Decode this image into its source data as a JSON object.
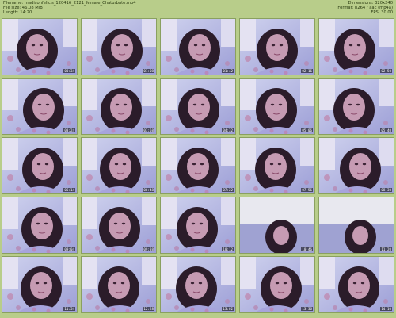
{
  "header": {
    "filename": "Filename: madisonfelicis_120416_2121_female_Chaturbate.mp4",
    "filesize": "File size: 46.08 MiB",
    "length": "Length: 14:20",
    "dimensions": "Dimensions: 320x240",
    "format": "Format: h264 / aac (mp4a)",
    "fps": "FPS: 30.00"
  },
  "thumbnails": [
    {
      "timestamp": "00:34",
      "variant": "face"
    },
    {
      "timestamp": "01:08",
      "variant": "face"
    },
    {
      "timestamp": "01:42",
      "variant": "face"
    },
    {
      "timestamp": "02:16",
      "variant": "face"
    },
    {
      "timestamp": "02:50",
      "variant": "face"
    },
    {
      "timestamp": "03:24",
      "variant": "face"
    },
    {
      "timestamp": "03:58",
      "variant": "face"
    },
    {
      "timestamp": "04:32",
      "variant": "face"
    },
    {
      "timestamp": "05:06",
      "variant": "face"
    },
    {
      "timestamp": "05:40",
      "variant": "face"
    },
    {
      "timestamp": "06:14",
      "variant": "face"
    },
    {
      "timestamp": "06:48",
      "variant": "face"
    },
    {
      "timestamp": "07:22",
      "variant": "face"
    },
    {
      "timestamp": "07:56",
      "variant": "face"
    },
    {
      "timestamp": "08:30",
      "variant": "face"
    },
    {
      "timestamp": "09:04",
      "variant": "face"
    },
    {
      "timestamp": "09:38",
      "variant": "face"
    },
    {
      "timestamp": "10:12",
      "variant": "face"
    },
    {
      "timestamp": "10:46",
      "variant": "wall"
    },
    {
      "timestamp": "11:20",
      "variant": "wall"
    },
    {
      "timestamp": "11:54",
      "variant": "face"
    },
    {
      "timestamp": "12:28",
      "variant": "face"
    },
    {
      "timestamp": "13:02",
      "variant": "face"
    },
    {
      "timestamp": "13:36",
      "variant": "face"
    },
    {
      "timestamp": "14:10",
      "variant": "face"
    }
  ]
}
